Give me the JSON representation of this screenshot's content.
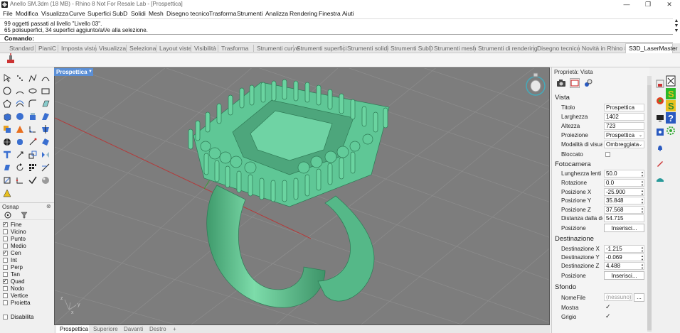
{
  "window": {
    "title": "Anello SM.3dm (18 MB) - Rhino 8 Not For Resale Lab - [Prospettica]",
    "minimize_glyph": "—",
    "restore_glyph": "❐",
    "close_glyph": "✕"
  },
  "menu": [
    "File",
    "Modifica",
    "Visualizza",
    "Curve",
    "Superfici",
    "SubD",
    "Solidi",
    "Mesh",
    "Disegno tecnico",
    "Trasforma",
    "Strumenti",
    "Analizza",
    "Rendering",
    "Finestra",
    "Aiuti"
  ],
  "command_history": [
    "99 oggetti passati al livello \"Livello 03\".",
    "65 polisuperfici, 34 superfici aggiunto/a/i/e alla selezione."
  ],
  "command_prompt": "Comando:",
  "toolbar_tabs": [
    "Standard",
    "PianiC",
    "Imposta vista",
    "Visualizza",
    "Seleziona",
    "Layout viste",
    "Visibilità",
    "Trasforma",
    "Strumenti curve",
    "Strumenti superfici",
    "Strumenti solidi",
    "Strumenti SubD",
    "Strumenti mesh",
    "Strumenti di rendering",
    "Disegno tecnico",
    "Novità in Rhino 8",
    "S3D_LaserMaster"
  ],
  "active_toolbar_tab": "S3D_LaserMaster",
  "viewport": {
    "label": "Prospettica",
    "tabs": [
      "Prospettica",
      "Superiore",
      "Davanti",
      "Destro",
      "+"
    ],
    "active_tab": "Prospettica",
    "axes": {
      "x": "x",
      "y": "y",
      "z": "z"
    }
  },
  "osnap": {
    "title": "Osnap",
    "close_glyph": "⊗",
    "items": [
      {
        "label": "Fine",
        "checked": true
      },
      {
        "label": "Vicino",
        "checked": false
      },
      {
        "label": "Punto",
        "checked": false
      },
      {
        "label": "Medio",
        "checked": false
      },
      {
        "label": "Cen",
        "checked": true
      },
      {
        "label": "Int",
        "checked": false
      },
      {
        "label": "Perp",
        "checked": false
      },
      {
        "label": "Tan",
        "checked": false
      },
      {
        "label": "Quad",
        "checked": true
      },
      {
        "label": "Nodo",
        "checked": false
      },
      {
        "label": "Vertice",
        "checked": false
      },
      {
        "label": "Proietta",
        "checked": false
      }
    ],
    "disable_label": "Disabilita",
    "disable_checked": false
  },
  "properties": {
    "title": "Proprietà: Vista",
    "close_glyph": "⊗",
    "sections": {
      "vista": "Vista",
      "fotocamera": "Fotocamera",
      "destinazione": "Destinazione",
      "sfondo": "Sfondo"
    },
    "vista": {
      "titolo_label": "Titolo",
      "titolo": "Prospettica",
      "larghezza_label": "Larghezza",
      "larghezza": "1402",
      "altezza_label": "Altezza",
      "altezza": "723",
      "proiezione_label": "Proiezione",
      "proiezione": "Prospettica",
      "modalita_label": "Modalità di visualizzazione",
      "modalita": "Ombreggiata",
      "bloccato_label": "Bloccato"
    },
    "fotocamera": {
      "lunghezza_label": "Lunghezza lenti (mm)",
      "lunghezza": "50.0",
      "rotazione_label": "Rotazione",
      "rotazione": "0.0",
      "pos_x_label": "Posizione X",
      "pos_x": "-25.900",
      "pos_y_label": "Posizione Y",
      "pos_y": "35.848",
      "pos_z_label": "Posizione Z",
      "pos_z": "37.568",
      "distanza_label": "Distanza dalla destinazione",
      "distanza": "54.715",
      "posizione_label": "Posizione",
      "inserisci": "Inserisci..."
    },
    "destinazione": {
      "x_label": "Destinazione X",
      "x": "-1.215",
      "y_label": "Destinazione Y",
      "y": "-0.069",
      "z_label": "Destinazione Z",
      "z": "4.488",
      "posizione_label": "Posizione",
      "inserisci": "Inserisci..."
    },
    "sfondo": {
      "nomefile_label": "NomeFile",
      "nomefile": "(nessuno)",
      "browse": "...",
      "mostra_label": "Mostra",
      "mostra": true,
      "grigio_label": "Grigio",
      "grigio": true
    }
  },
  "colors": {
    "viewport_bg": "#7d7d7d",
    "model_green": "#5fc796",
    "x_axis": "#b33a3a",
    "y_axis": "#3a9a3a",
    "active_label": "#5b8fd6"
  }
}
